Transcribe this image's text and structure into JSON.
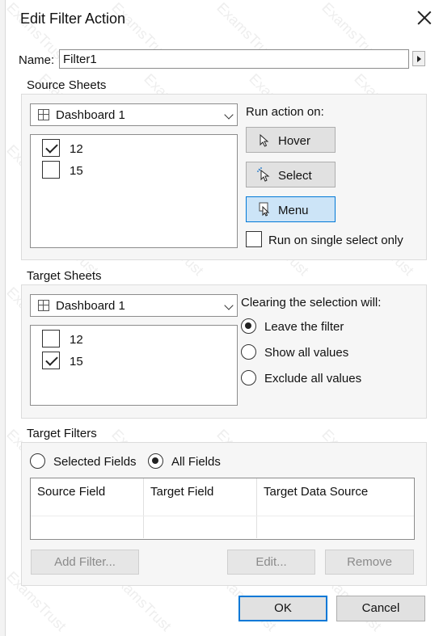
{
  "dialog": {
    "title": "Edit Filter Action",
    "name_label": "Name:",
    "name_value": "Filter1"
  },
  "source": {
    "section_label": "Source Sheets",
    "dropdown_value": "Dashboard 1",
    "sheets": [
      {
        "label": "12",
        "checked": true
      },
      {
        "label": "15",
        "checked": false
      }
    ],
    "run_action_label": "Run action on:",
    "hover_label": "Hover",
    "select_label": "Select",
    "menu_label": "Menu",
    "single_select_label": "Run on single select only"
  },
  "target": {
    "section_label": "Target Sheets",
    "dropdown_value": "Dashboard 1",
    "sheets": [
      {
        "label": "12",
        "checked": false
      },
      {
        "label": "15",
        "checked": true
      }
    ],
    "clearing_label": "Clearing the selection will:",
    "options": [
      "Leave the filter",
      "Show all values",
      "Exclude all values"
    ],
    "selected_option": 0
  },
  "filters": {
    "section_label": "Target Filters",
    "selected_fields_label": "Selected Fields",
    "all_fields_label": "All Fields",
    "columns": [
      "Source Field",
      "Target Field",
      "Target Data Source"
    ],
    "add_filter_label": "Add Filter...",
    "edit_label": "Edit...",
    "remove_label": "Remove"
  },
  "footer": {
    "ok_label": "OK",
    "cancel_label": "Cancel"
  },
  "watermark": "ExamsTrust"
}
